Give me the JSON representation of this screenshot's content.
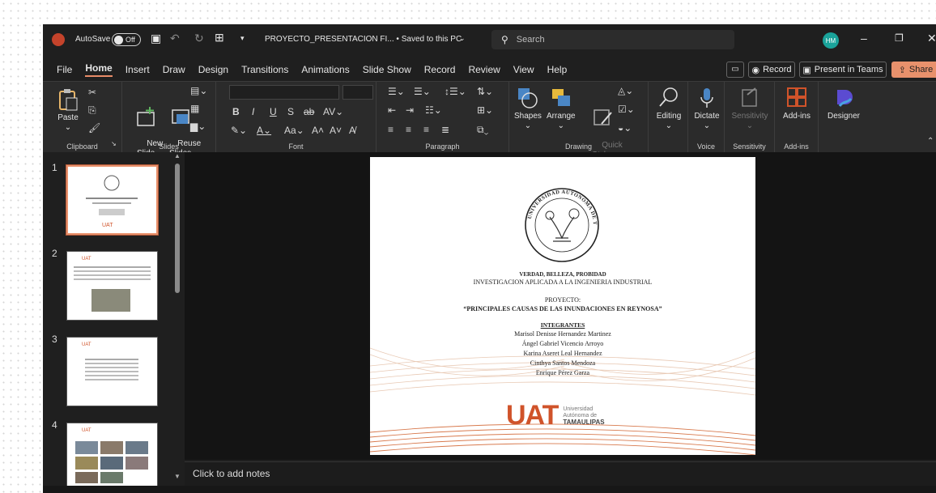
{
  "titlebar": {
    "autosave_label": "AutoSave",
    "autosave_state": "Off",
    "doc_title": "PROYECTO_PRESENTACION FI... • Saved to this PC",
    "search_placeholder": "Search",
    "user_initials": "HM"
  },
  "tabs": [
    "File",
    "Home",
    "Insert",
    "Draw",
    "Design",
    "Transitions",
    "Animations",
    "Slide Show",
    "Record",
    "Review",
    "View",
    "Help"
  ],
  "tab_selected": "Home",
  "ribbon_right": {
    "record": "Record",
    "present": "Present in Teams",
    "share": "Share"
  },
  "ribbon": {
    "paste": "Paste",
    "new_slide": "New\nSlide",
    "reuse_slides": "Reuse\nSlides",
    "shapes": "Shapes",
    "arrange": "Arrange",
    "quick_styles": "Quick\nStyles",
    "editing": "Editing",
    "dictate": "Dictate",
    "sensitivity": "Sensitivity",
    "addins": "Add-ins",
    "designer": "Designer",
    "groups": {
      "clipboard": "Clipboard",
      "slides": "Slides",
      "font": "Font",
      "paragraph": "Paragraph",
      "drawing": "Drawing",
      "voice": "Voice",
      "sensitivity": "Sensitivity",
      "addins": "Add-ins"
    }
  },
  "thumbnails": [
    {
      "num": "1"
    },
    {
      "num": "2"
    },
    {
      "num": "3"
    },
    {
      "num": "4"
    }
  ],
  "slide": {
    "seal_top": "UNIVERSIDAD AUTONOMA DE TAMAULIPAS",
    "motto": "VERDAD, BELLEZA, PROBIDAD",
    "course": "INVESTIGACION APLICADA A LA INGENIERIA INDUSTRIAL",
    "project_label": "PROYECTO:",
    "project_title": "“PRINCIPALES CAUSAS DE LAS INUNDACIONES EN REYNOSA”",
    "members_label": "INTEGRANTES",
    "members": [
      "Marisol Denisse Hernandez Martinez",
      "Ángel Gabriel Vicencio Arroyo",
      "Karina Aseret Leal Hernandez",
      "Cinthya Santos Mendoza",
      "Enrique Pérez Garza"
    ],
    "logo_text": "UAT",
    "logo_line1": "Universidad",
    "logo_line2": "Autónoma de",
    "logo_line3": "TAMAULIPAS"
  },
  "notes_placeholder": "Click to add notes",
  "colors": {
    "accent": "#e8916c",
    "logo": "#d0532a"
  }
}
